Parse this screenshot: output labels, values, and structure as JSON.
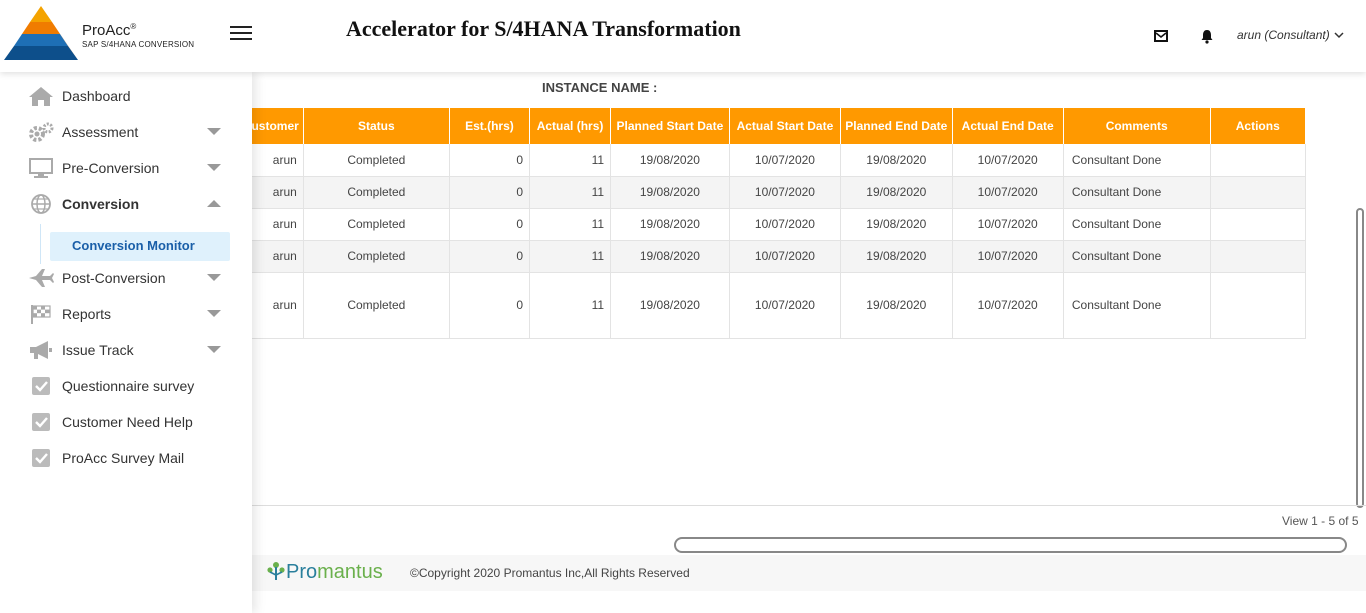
{
  "header": {
    "brand_name": "ProAcc",
    "brand_reg": "®",
    "brand_sub": "SAP S/4HANA CONVERSION",
    "app_title": "Accelerator for S/4HANA Transformation",
    "user": "arun (Consultant)"
  },
  "sidebar": {
    "items": [
      {
        "label": "Dashboard"
      },
      {
        "label": "Assessment"
      },
      {
        "label": "Pre-Conversion"
      },
      {
        "label": "Conversion"
      },
      {
        "label": "Post-Conversion"
      },
      {
        "label": "Reports"
      },
      {
        "label": "Issue Track"
      },
      {
        "label": "Questionnaire survey"
      },
      {
        "label": "Customer Need Help"
      },
      {
        "label": "ProAcc Survey Mail"
      }
    ],
    "subitem": "Conversion Monitor"
  },
  "main": {
    "instance_label": "INSTANCE NAME :",
    "columns": [
      "Customer",
      "Status",
      "Est.(hrs)",
      "Actual (hrs)",
      "Planned Start Date",
      "Actual Start Date",
      "Planned End Date",
      "Actual End Date",
      "Comments",
      "Actions"
    ],
    "rows": [
      {
        "customer": "arun",
        "status": "Completed",
        "est": "0",
        "actual": "11",
        "planned_start": "19/08/2020",
        "actual_start": "10/07/2020",
        "planned_end": "19/08/2020",
        "actual_end": "10/07/2020",
        "comments": "Consultant Done",
        "actions": ""
      },
      {
        "customer": "arun",
        "status": "Completed",
        "est": "0",
        "actual": "11",
        "planned_start": "19/08/2020",
        "actual_start": "10/07/2020",
        "planned_end": "19/08/2020",
        "actual_end": "10/07/2020",
        "comments": "Consultant Done",
        "actions": ""
      },
      {
        "customer": "arun",
        "status": "Completed",
        "est": "0",
        "actual": "11",
        "planned_start": "19/08/2020",
        "actual_start": "10/07/2020",
        "planned_end": "19/08/2020",
        "actual_end": "10/07/2020",
        "comments": "Consultant Done",
        "actions": ""
      },
      {
        "customer": "arun",
        "status": "Completed",
        "est": "0",
        "actual": "11",
        "planned_start": "19/08/2020",
        "actual_start": "10/07/2020",
        "planned_end": "19/08/2020",
        "actual_end": "10/07/2020",
        "comments": "Consultant Done",
        "actions": ""
      },
      {
        "customer": "arun",
        "status": "Completed",
        "est": "0",
        "actual": "11",
        "planned_start": "19/08/2020",
        "actual_start": "10/07/2020",
        "planned_end": "19/08/2020",
        "actual_end": "10/07/2020",
        "comments": "Consultant Done",
        "actions": ""
      }
    ],
    "view_count": "View 1 - 5 of 5"
  },
  "footer": {
    "logo_part1": "Pro",
    "logo_part2": "mantus",
    "copyright": "©Copyright 2020 Promantus Inc,All Rights Reserved"
  },
  "colors": {
    "accent": "#ff9900",
    "active_sub_bg": "#dff1fc",
    "active_sub_text": "#1a5fa8"
  }
}
